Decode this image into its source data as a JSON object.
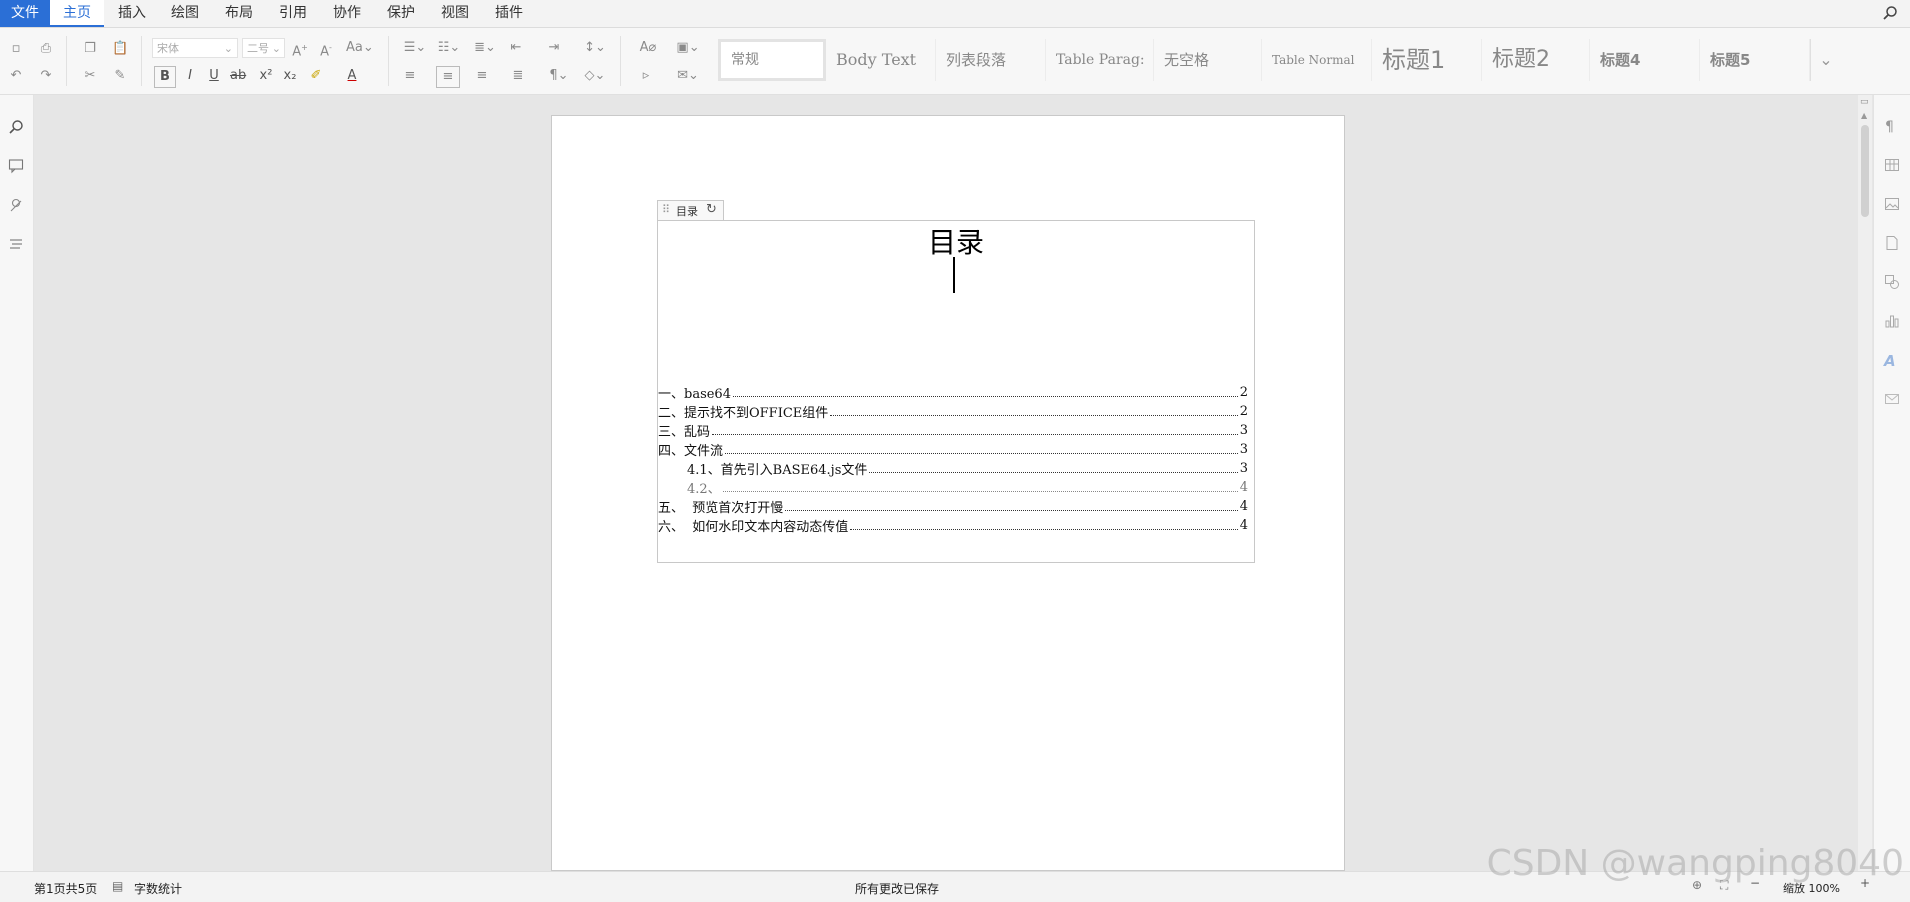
{
  "menu": {
    "items": [
      "文件",
      "主页",
      "插入",
      "绘图",
      "布局",
      "引用",
      "协作",
      "保护",
      "视图",
      "插件"
    ]
  },
  "toolbar": {
    "font_name": "宋体",
    "font_size": "二号",
    "styles": [
      "常规",
      "Body Text",
      "列表段落",
      "Table Parag:",
      "无空格",
      "Table Normal",
      "标题1",
      "标题2",
      "标题4",
      "标题5"
    ]
  },
  "toc": {
    "tab_label": "目录",
    "title": "目录",
    "entries": [
      {
        "text": "一、base64",
        "page": "2"
      },
      {
        "text": "二、提示找不到OFFICE组件",
        "page": "2"
      },
      {
        "text": "三、乱码",
        "page": "3"
      },
      {
        "text": "四、文件流",
        "page": "3"
      },
      {
        "text": "4.1、首先引入BASE64.js文件",
        "page": "3"
      },
      {
        "text": "4.2、",
        "page": "4"
      },
      {
        "text": "五、  预览首次打开慢",
        "page": "4"
      },
      {
        "text": "六、  如何水印文本内容动态传值",
        "page": "4"
      }
    ]
  },
  "status": {
    "page_info": "第1页共5页",
    "word_count": "字数统计",
    "save_status": "所有更改已保存",
    "zoom": "缩放 100%"
  },
  "watermark": "CSDN @wangping8040",
  "colors": {
    "accent": "#2b6fd6"
  }
}
